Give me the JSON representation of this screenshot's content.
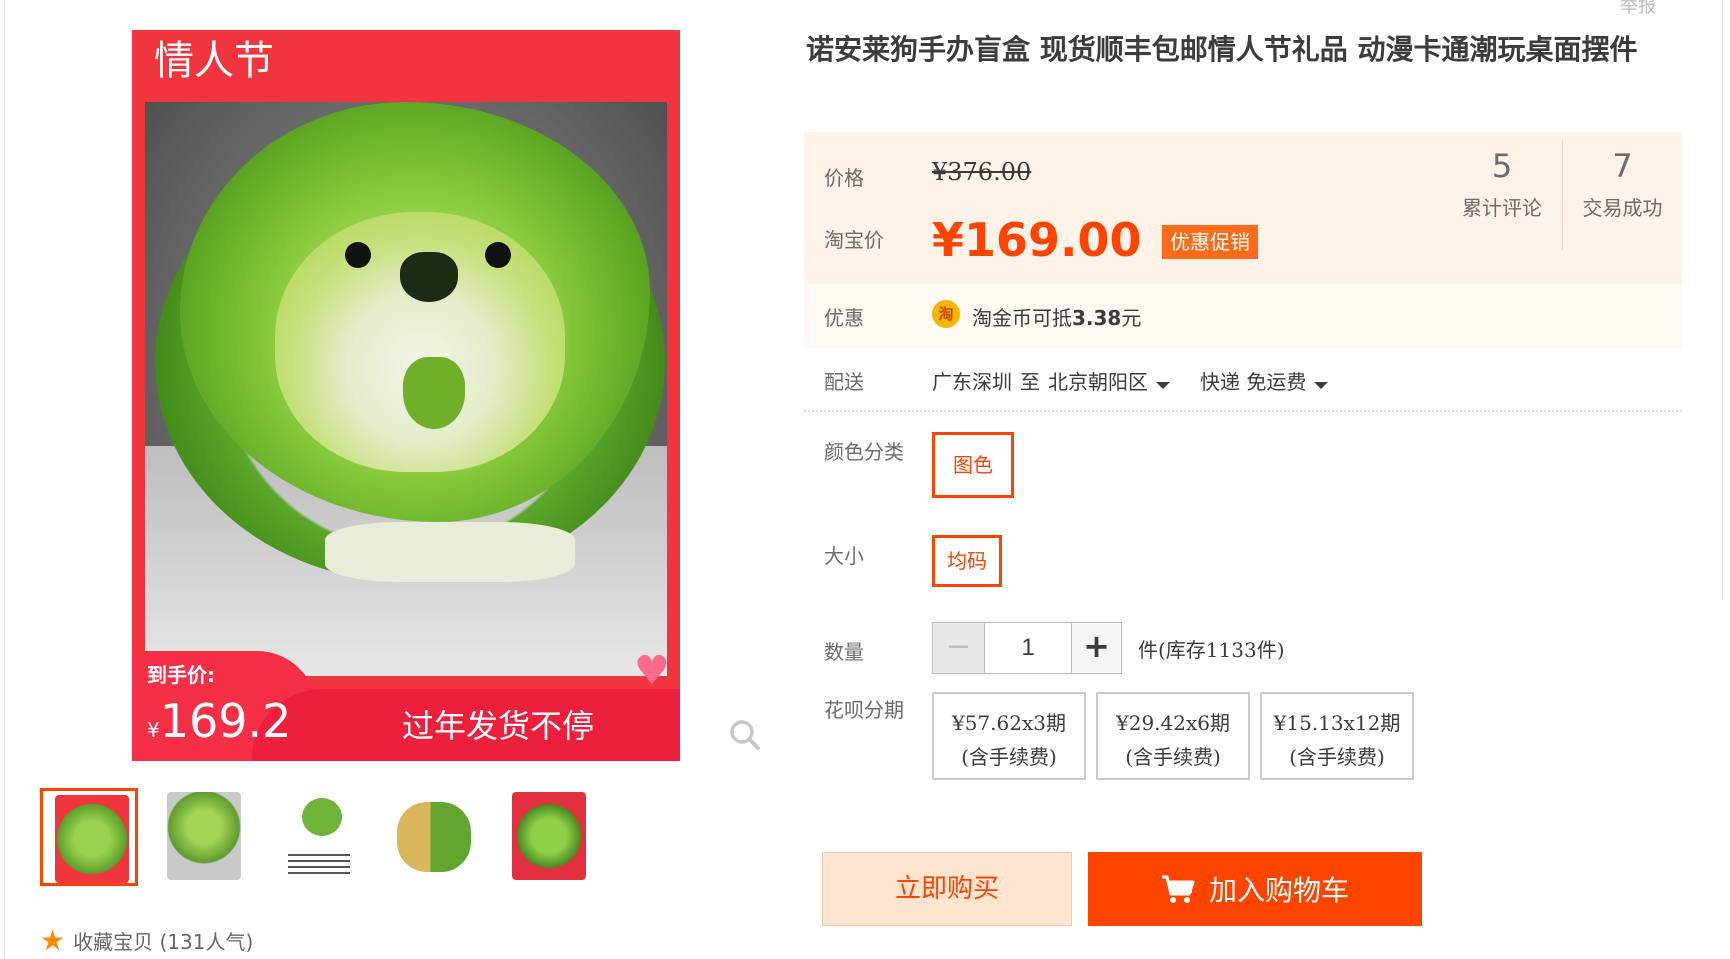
{
  "gallery": {
    "badge": "情人节",
    "arrive_label": "到手价:",
    "arrive_currency": "¥",
    "arrive_price": "169.2",
    "slogan": "过年发货不停",
    "favorite_label": "收藏宝贝 (131人气)"
  },
  "product": {
    "title": "诺安莱狗手办盲盒 现货顺丰包邮情人节礼品 动漫卡通潮玩桌面摆件",
    "top_right_text": "举报"
  },
  "price": {
    "label": "价格",
    "original": "¥376.00",
    "taobao_label": "淘宝价",
    "current": "¥169.00",
    "promo_tag": "优惠促销"
  },
  "stats": [
    {
      "num": "5",
      "caption": "累计评论"
    },
    {
      "num": "7",
      "caption": "交易成功"
    }
  ],
  "discount": {
    "label": "优惠",
    "coin_icon_text": "淘",
    "text_prefix": "淘金币可抵",
    "amount": "3.38",
    "text_suffix": "元"
  },
  "shipping": {
    "label": "配送",
    "from": "广东深圳",
    "to_word": "至",
    "to": "北京朝阳区",
    "method": "快递 免运费"
  },
  "options": {
    "color_label": "颜色分类",
    "color_value": "图色",
    "size_label": "大小",
    "size_value": "均码"
  },
  "quantity": {
    "label": "数量",
    "minus": "−",
    "value": "1",
    "plus": "+",
    "stock": "件(库存1133件)"
  },
  "installments": {
    "label": "花呗分期",
    "plans": [
      {
        "amount": "¥57.62x3期",
        "note": "(含手续费)"
      },
      {
        "amount": "¥29.42x6期",
        "note": "(含手续费)"
      },
      {
        "amount": "¥15.13x12期",
        "note": "(含手续费)"
      }
    ]
  },
  "actions": {
    "buy_now": "立即购买",
    "add_cart": "加入购物车"
  },
  "colors": {
    "accent": "#ff4400",
    "badge_red": "#f1353e",
    "price_panel_bg": "#fff2e8"
  }
}
